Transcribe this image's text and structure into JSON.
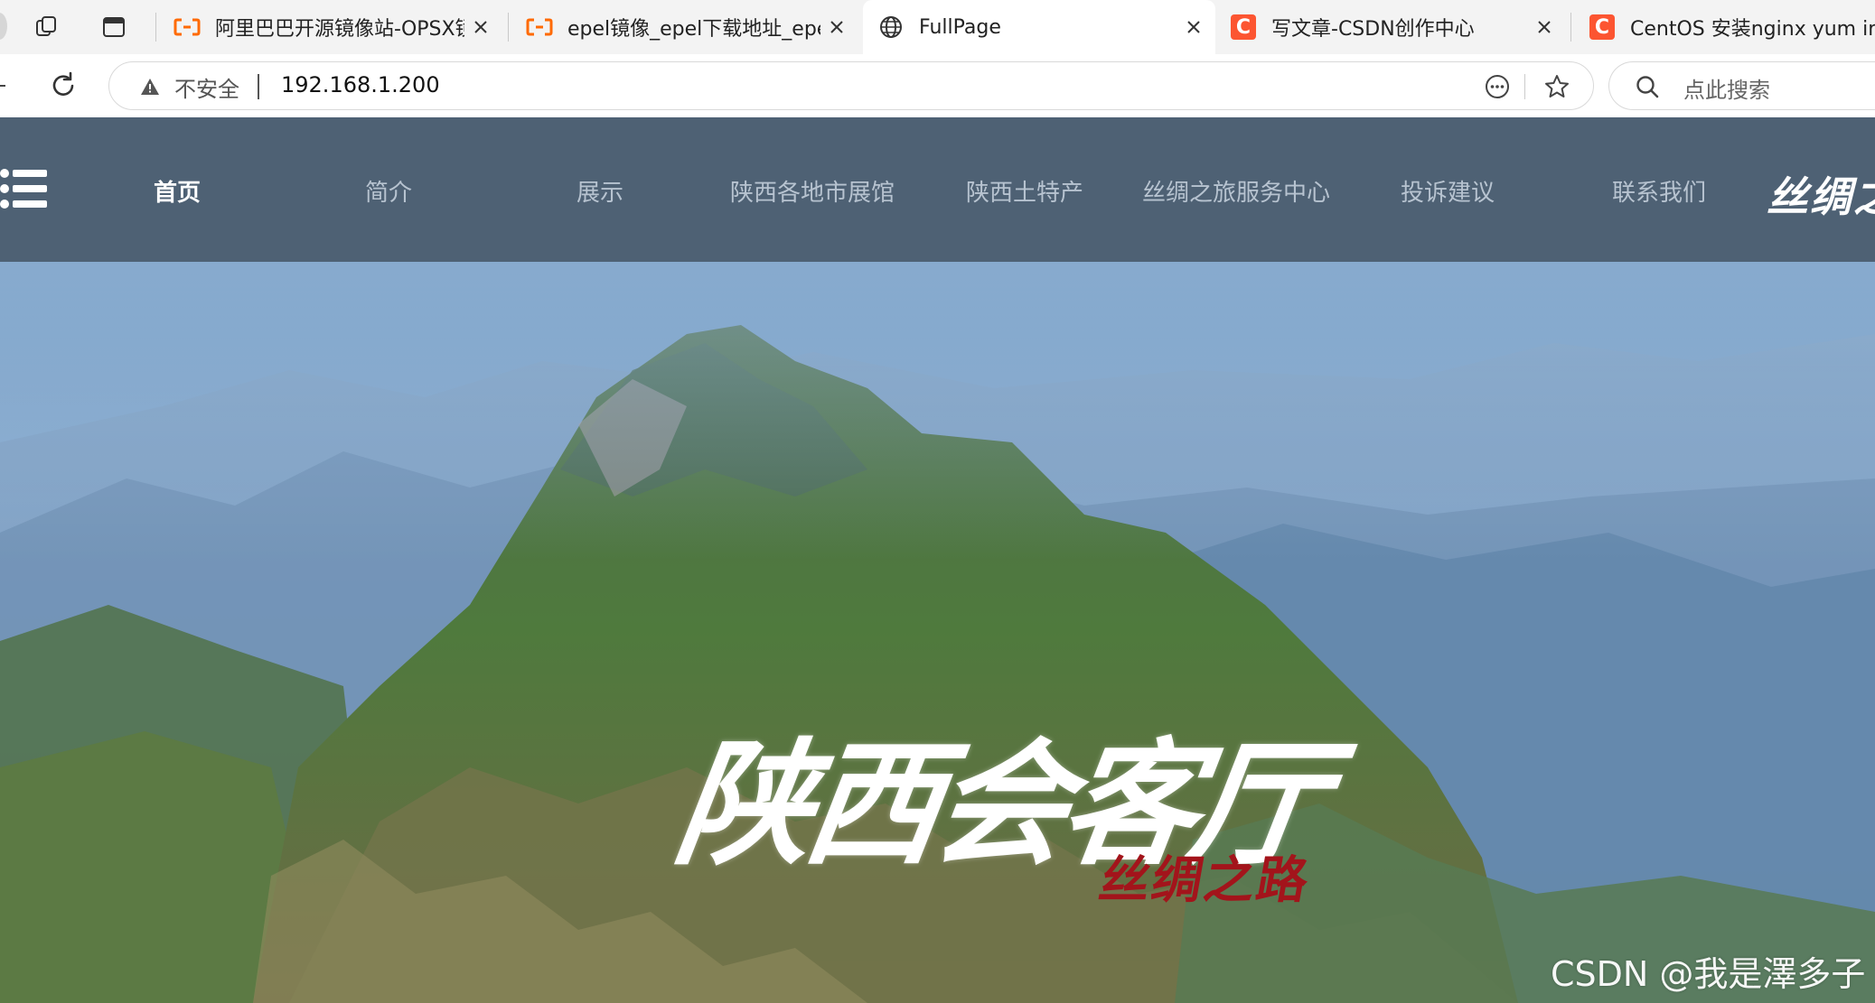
{
  "browser": {
    "tabs": [
      {
        "title": "阿里巴巴开源镜像站-OPSX镜像",
        "icon": "aliyun-icon",
        "active": false
      },
      {
        "title": "epel镜像_epel下载地址_epel安",
        "icon": "aliyun-icon",
        "active": false
      },
      {
        "title": "FullPage",
        "icon": "globe-icon",
        "active": true
      },
      {
        "title": "写文章-CSDN创作中心",
        "icon": "csdn-icon",
        "active": false
      },
      {
        "title": "CentOS 安装nginx yum install",
        "icon": "csdn-icon",
        "active": false
      }
    ],
    "csdn_glyph": "C",
    "address": {
      "security_label": "不安全",
      "url": "192.168.1.200"
    },
    "search": {
      "placeholder": "点此搜索"
    }
  },
  "site": {
    "nav": [
      {
        "label": "首页",
        "current": true
      },
      {
        "label": "简介",
        "current": false
      },
      {
        "label": "展示",
        "current": false
      },
      {
        "label": "陕西各地市展馆",
        "current": false
      },
      {
        "label": "陕西土特产",
        "current": false
      },
      {
        "label": "丝绸之旅服务中心",
        "current": false
      },
      {
        "label": "投诉建议",
        "current": false
      },
      {
        "label": "联系我们",
        "current": false
      }
    ],
    "logo_text": "丝绸之",
    "hero": {
      "title": "陕西会客厅",
      "subtitle": "丝绸之路"
    },
    "watermark": "CSDN @我是澤多子"
  },
  "colors": {
    "navbar_bg": "#4e6174",
    "nav_text": "#b7c3d0",
    "nav_current": "#ffffff",
    "hero_subtitle": "#a3141b",
    "csdn_brand": "#fc5531",
    "aliyun_brand": "#ff6a00"
  }
}
